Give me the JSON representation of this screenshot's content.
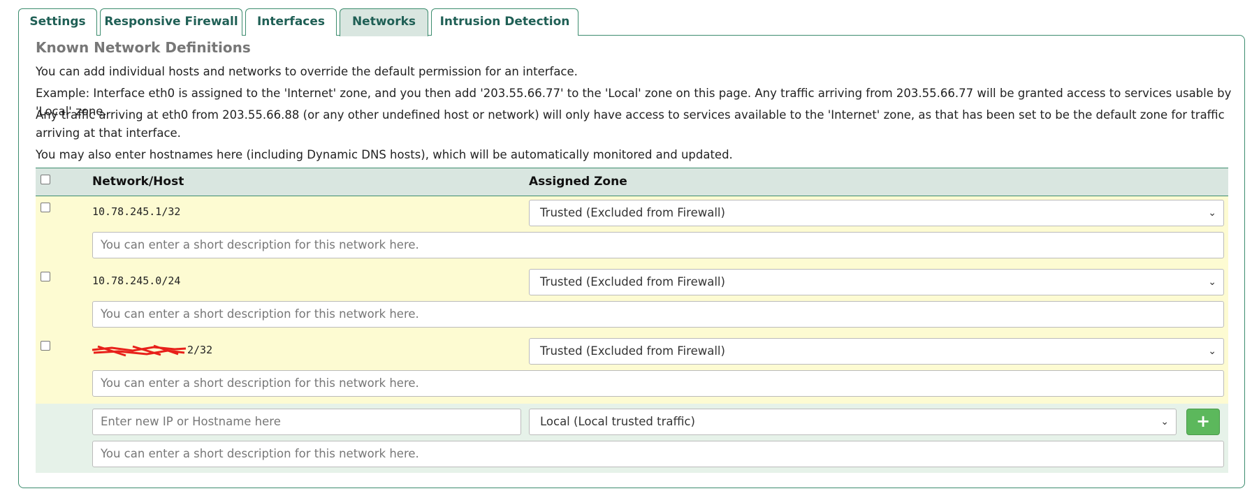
{
  "tabs": [
    {
      "label": "Settings",
      "active": false
    },
    {
      "label": "Responsive Firewall",
      "active": false
    },
    {
      "label": "Interfaces",
      "active": false
    },
    {
      "label": "Networks",
      "active": true
    },
    {
      "label": "Intrusion Detection",
      "active": false
    }
  ],
  "section": {
    "title": "Known Network Definitions",
    "paragraphs": [
      "You can add individual hosts and networks to override the default permission for an interface.",
      "Example: Interface eth0 is assigned to the 'Internet' zone, and you then add '203.55.66.77' to the 'Local' zone on this page. Any traffic arriving from 203.55.66.77 will be granted access to services usable by 'Local' zone.",
      "Any traffic arriving at eth0 from 203.55.66.88 (or any other undefined host or network) will only have access to services available to the 'Internet' zone, as that has been set to be the default zone for traffic arriving at that interface.",
      "You may also enter hostnames here (including Dynamic DNS hosts), which will be automatically monitored and updated."
    ]
  },
  "table": {
    "headers": {
      "network": "Network/Host",
      "zone": "Assigned Zone"
    },
    "rows": [
      {
        "network": "10.78.245.1/32",
        "zone": "Trusted (Excluded from Firewall)",
        "description_placeholder": "You can enter a short description for this network here."
      },
      {
        "network": "10.78.245.0/24",
        "zone": "Trusted (Excluded from Firewall)",
        "description_placeholder": "You can enter a short description for this network here."
      },
      {
        "network": "2/32",
        "zone": "Trusted (Excluded from Firewall)",
        "description_placeholder": "You can enter a short description for this network here.",
        "redacted_prefix": true
      }
    ],
    "new_entry": {
      "network_placeholder": "Enter new IP or Hostname here",
      "zone": "Local (Local trusted traffic)",
      "description_placeholder": "You can enter a short description for this network here.",
      "add_button": "+"
    }
  },
  "colors": {
    "accent": "#3c8c6e",
    "tab_text": "#1f5f55",
    "header_bg": "#d9e6e0",
    "row_bg": "#fdfbd2",
    "new_row_bg": "#e6f2e9",
    "add_button": "#5cb85c"
  },
  "icons": {
    "select_arrow": "chevron-down-icon",
    "add": "plus-icon"
  }
}
